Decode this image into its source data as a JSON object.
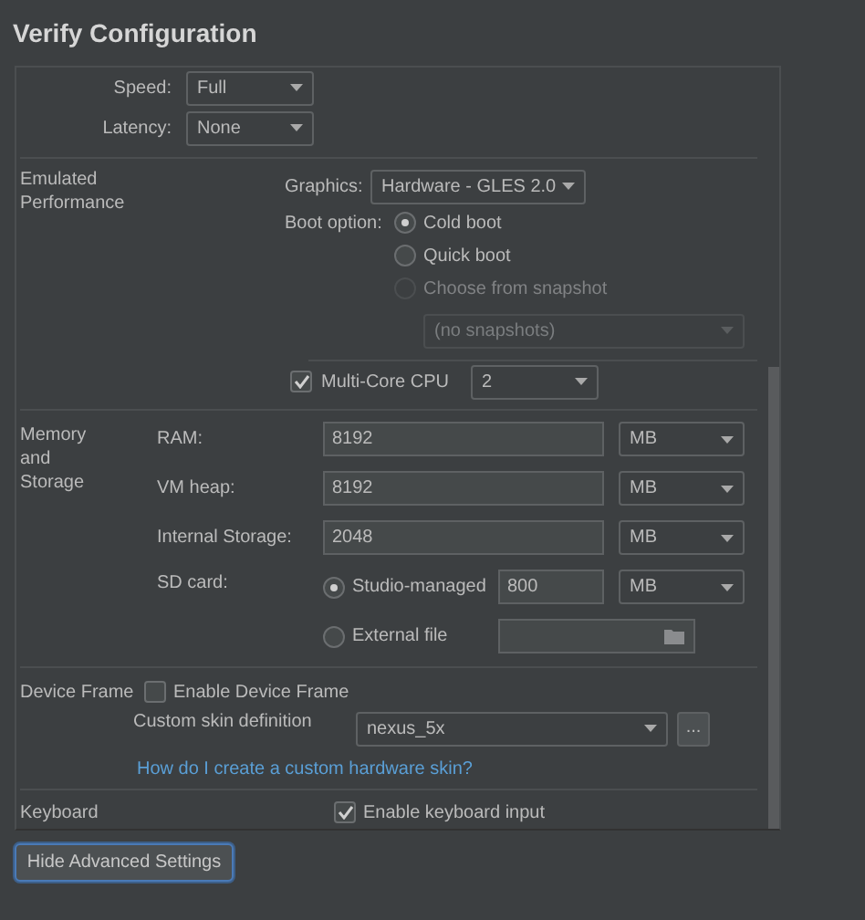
{
  "title": "Verify Configuration",
  "network": {
    "rows": [
      {
        "label": "Speed:",
        "value": "Full"
      },
      {
        "label": "Latency:",
        "value": "None"
      }
    ]
  },
  "emulated_performance": {
    "label": "Emulated Performance",
    "graphics": {
      "label": "Graphics:",
      "value": "Hardware - GLES 2.0"
    },
    "boot_option": {
      "label": "Boot option:",
      "options": [
        {
          "label": "Cold boot",
          "selected": true,
          "disabled": false
        },
        {
          "label": "Quick boot",
          "selected": false,
          "disabled": false
        },
        {
          "label": "Choose from snapshot",
          "selected": false,
          "disabled": true
        }
      ]
    },
    "snapshot": {
      "value": "(no snapshots)",
      "disabled": true
    },
    "multi_core": {
      "label": "Multi-Core CPU",
      "checked": true,
      "value": "2"
    }
  },
  "memory_and_storage": {
    "label": "Memory and Storage",
    "rows": [
      {
        "label": "RAM:",
        "value": "8192",
        "unit": "MB"
      },
      {
        "label": "VM heap:",
        "value": "8192",
        "unit": "MB"
      },
      {
        "label": "Internal Storage:",
        "value": "2048",
        "unit": "MB"
      }
    ],
    "sd_card": {
      "label": "SD card:",
      "options": [
        {
          "kind": "size",
          "label": "Studio-managed",
          "selected": true,
          "value": "800",
          "unit": "MB"
        },
        {
          "kind": "file",
          "label": "External file",
          "selected": false
        }
      ]
    }
  },
  "device_frame": {
    "label": "Device Frame",
    "enable": {
      "label": "Enable Device Frame",
      "checked": false
    },
    "custom_skin": {
      "label": "Custom skin definition",
      "value": "nexus_5x",
      "button": "..."
    },
    "link": "How do I create a custom hardware skin?"
  },
  "keyboard": {
    "label": "Keyboard",
    "enable": {
      "label": "Enable keyboard input",
      "checked": true
    }
  },
  "button": "Hide Advanced Settings"
}
